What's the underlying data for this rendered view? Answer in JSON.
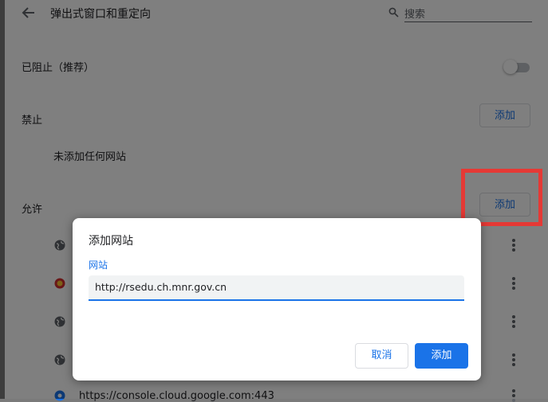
{
  "header": {
    "title": "弹出式窗口和重定向",
    "search_placeholder": "搜索"
  },
  "blocked_setting": {
    "label": "已阻止（推荐）",
    "enabled": false
  },
  "block_section": {
    "title": "禁止",
    "add_label": "添加",
    "empty_text": "未添加任何网站"
  },
  "allow_section": {
    "title": "允许",
    "add_label": "添加",
    "partial_site": "https://console.cloud.google.com:443"
  },
  "dialog": {
    "title": "添加网站",
    "field_label": "网站",
    "field_value": "http://rsedu.ch.mnr.gov.cn",
    "cancel_label": "取消",
    "add_label": "添加"
  },
  "colors": {
    "accent": "#1a73e8",
    "highlight_box": "#e53935"
  }
}
